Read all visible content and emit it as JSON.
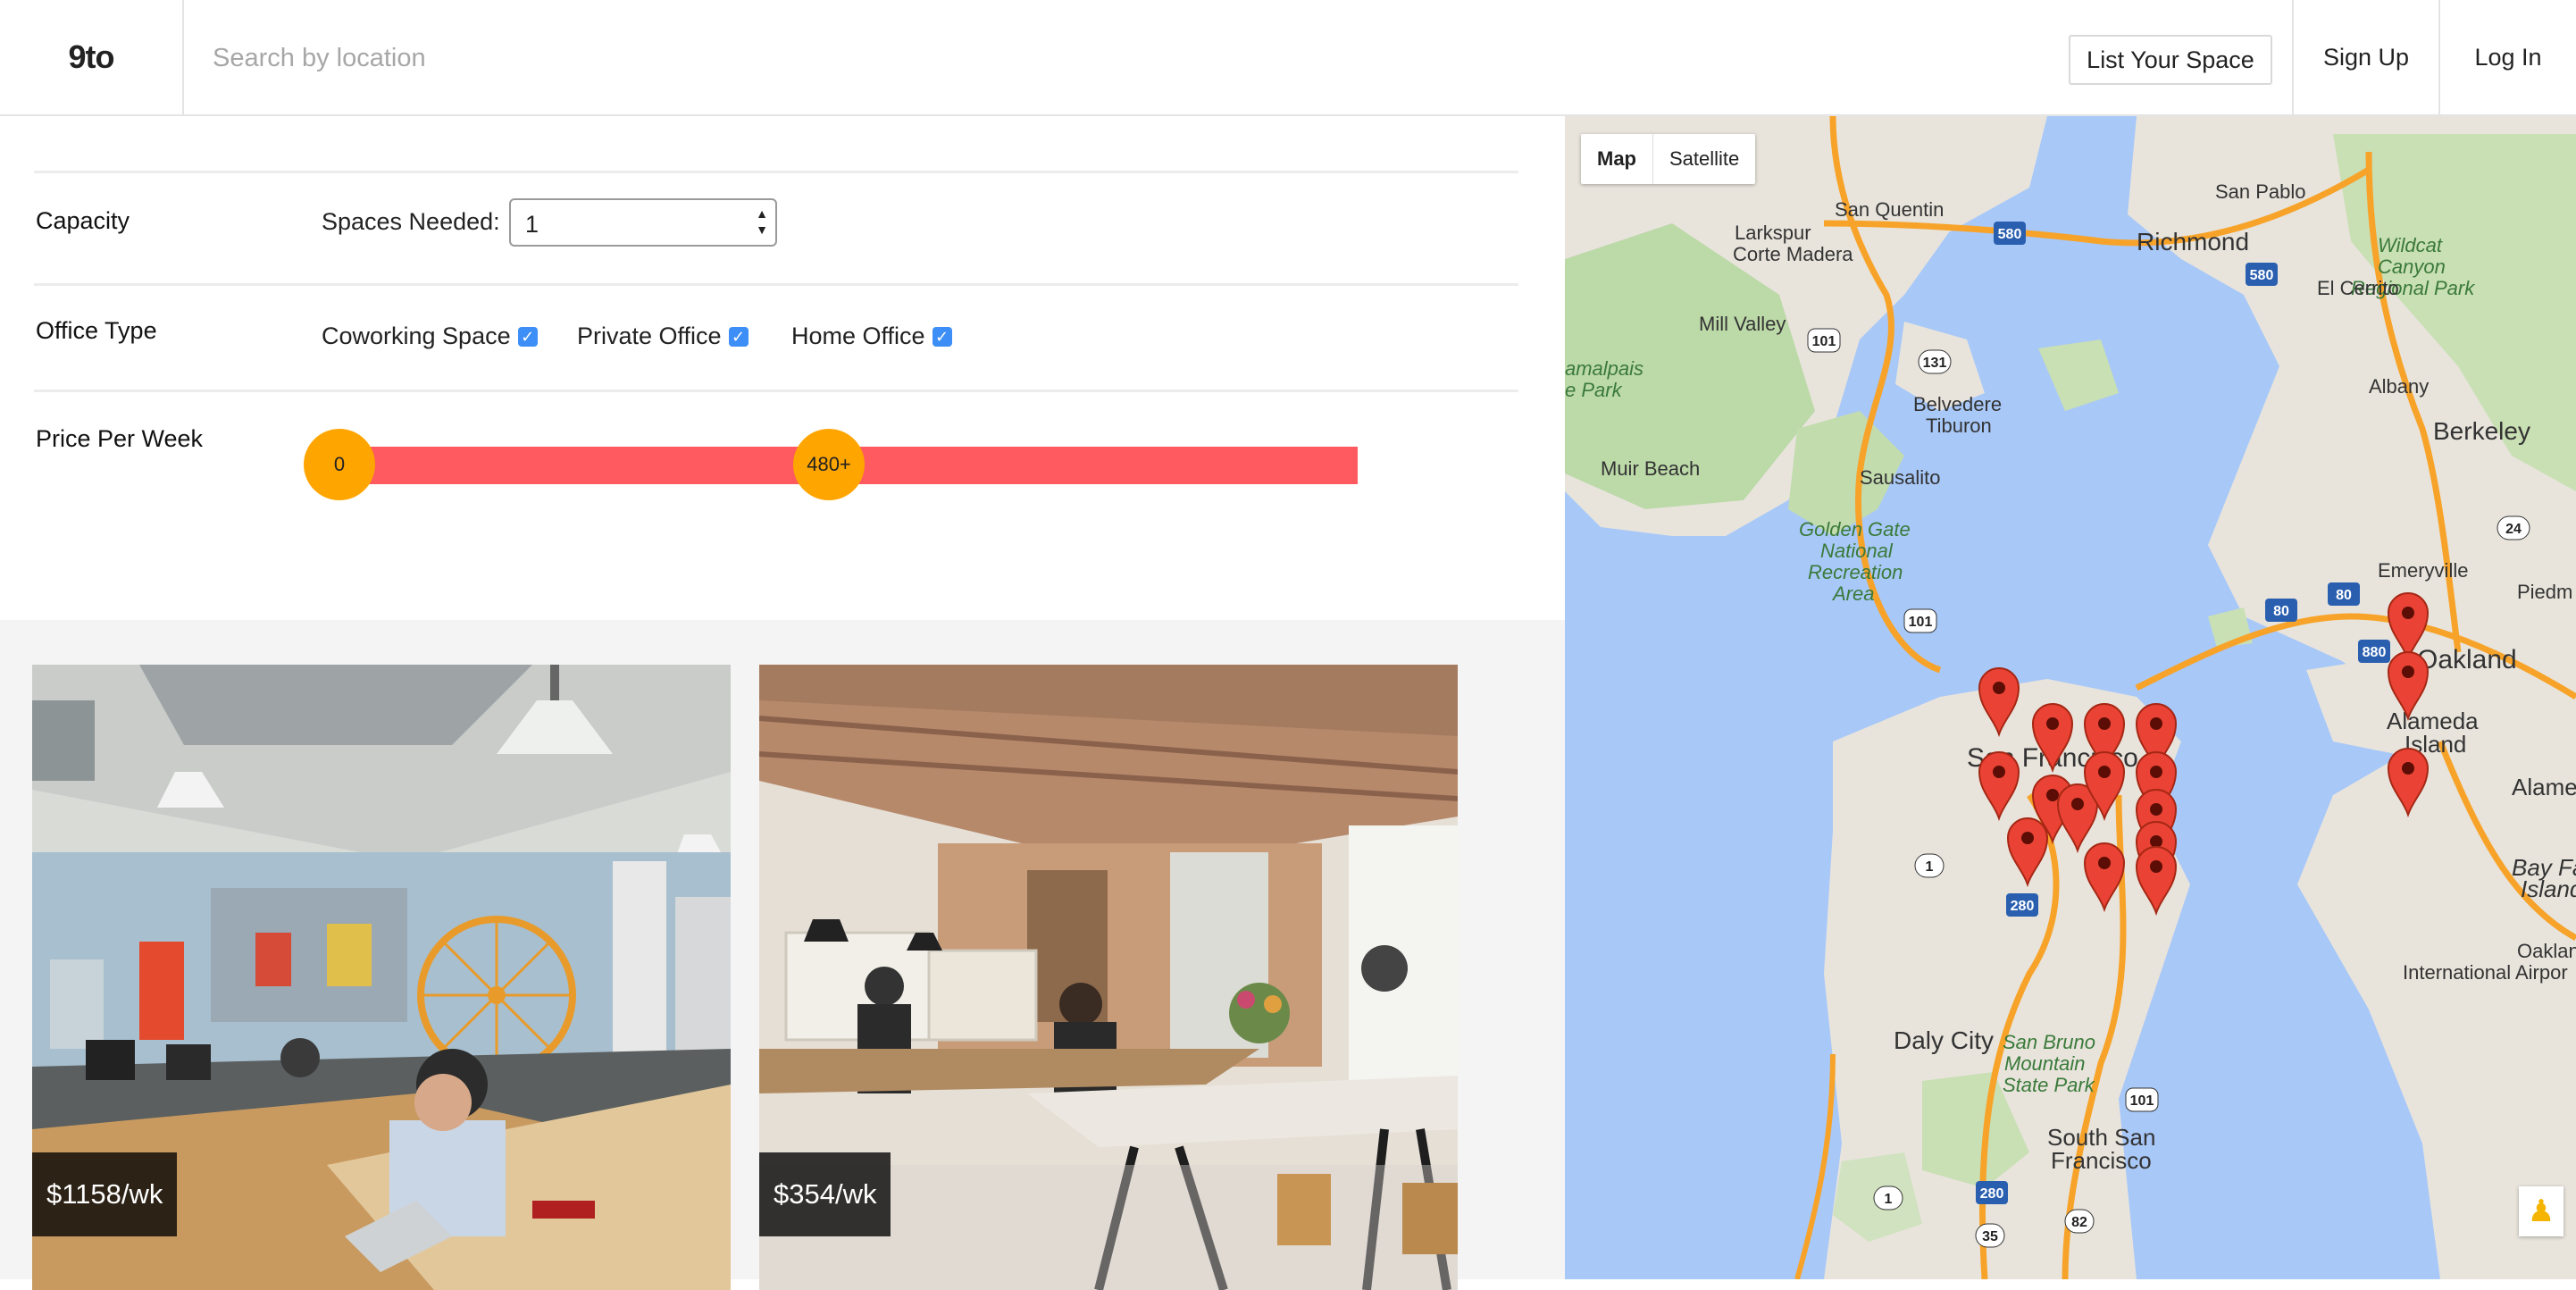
{
  "header": {
    "logo": "9to",
    "search_placeholder": "Search by location",
    "list_space_label": "List Your Space",
    "signup_label": "Sign Up",
    "login_label": "Log In"
  },
  "filters": {
    "capacity": {
      "label": "Capacity",
      "spaces_needed_label": "Spaces Needed:",
      "selected": "1"
    },
    "office_type": {
      "label": "Office Type",
      "options": [
        {
          "label": "Coworking Space",
          "checked": true
        },
        {
          "label": "Private Office",
          "checked": true
        },
        {
          "label": "Home Office",
          "checked": true
        }
      ]
    },
    "price": {
      "label": "Price Per Week",
      "min_label": "0",
      "max_label": "480+"
    }
  },
  "listings": [
    {
      "price": "$1158/wk"
    },
    {
      "price": "$354/wk"
    }
  ],
  "map": {
    "toggle": {
      "map": "Map",
      "satellite": "Satellite"
    },
    "places": {
      "san_pablo": "San Pablo",
      "san_quentin": "San Quentin",
      "richmond": "Richmond",
      "wildcat": "Wildcat",
      "canyon": "Canyon",
      "regional_park": "Regional Park",
      "larkspur": "Larkspur",
      "corte_madera": "Corte Madera",
      "el_cerrito": "El Cerrito",
      "mill_valley": "Mill Valley",
      "albany": "Albany",
      "belvedere": "Belvedere",
      "tiburon": "Tiburon",
      "berkeley": "Berkeley",
      "muir_beach": "Muir Beach",
      "sausalito": "Sausalito",
      "golden_gate": "Golden Gate",
      "national": "National",
      "recreation": "Recreation",
      "area": "Area",
      "emeryville": "Emeryville",
      "piedmont": "Piedm",
      "oakland": "Oakland",
      "san_francisco": "San Francisco",
      "alameda": "Alameda",
      "island": "Island",
      "alamed": "Alamed",
      "bay_farm": "Bay Farm",
      "islan": "Island",
      "oakland2": "Oakland",
      "international_airport": "International Airpor",
      "daly_city": "Daly City",
      "san_bruno": "San Bruno",
      "mountain": "Mountain",
      "state_park": "State Park",
      "south_sf": "South San",
      "francisco": "Francisco",
      "marin_park": "amalpais",
      "park": "e Park"
    },
    "shields": [
      "580",
      "580",
      "101",
      "131",
      "101",
      "80",
      "80",
      "880",
      "24",
      "1",
      "280",
      "101",
      "280",
      "1",
      "82",
      "35"
    ]
  }
}
